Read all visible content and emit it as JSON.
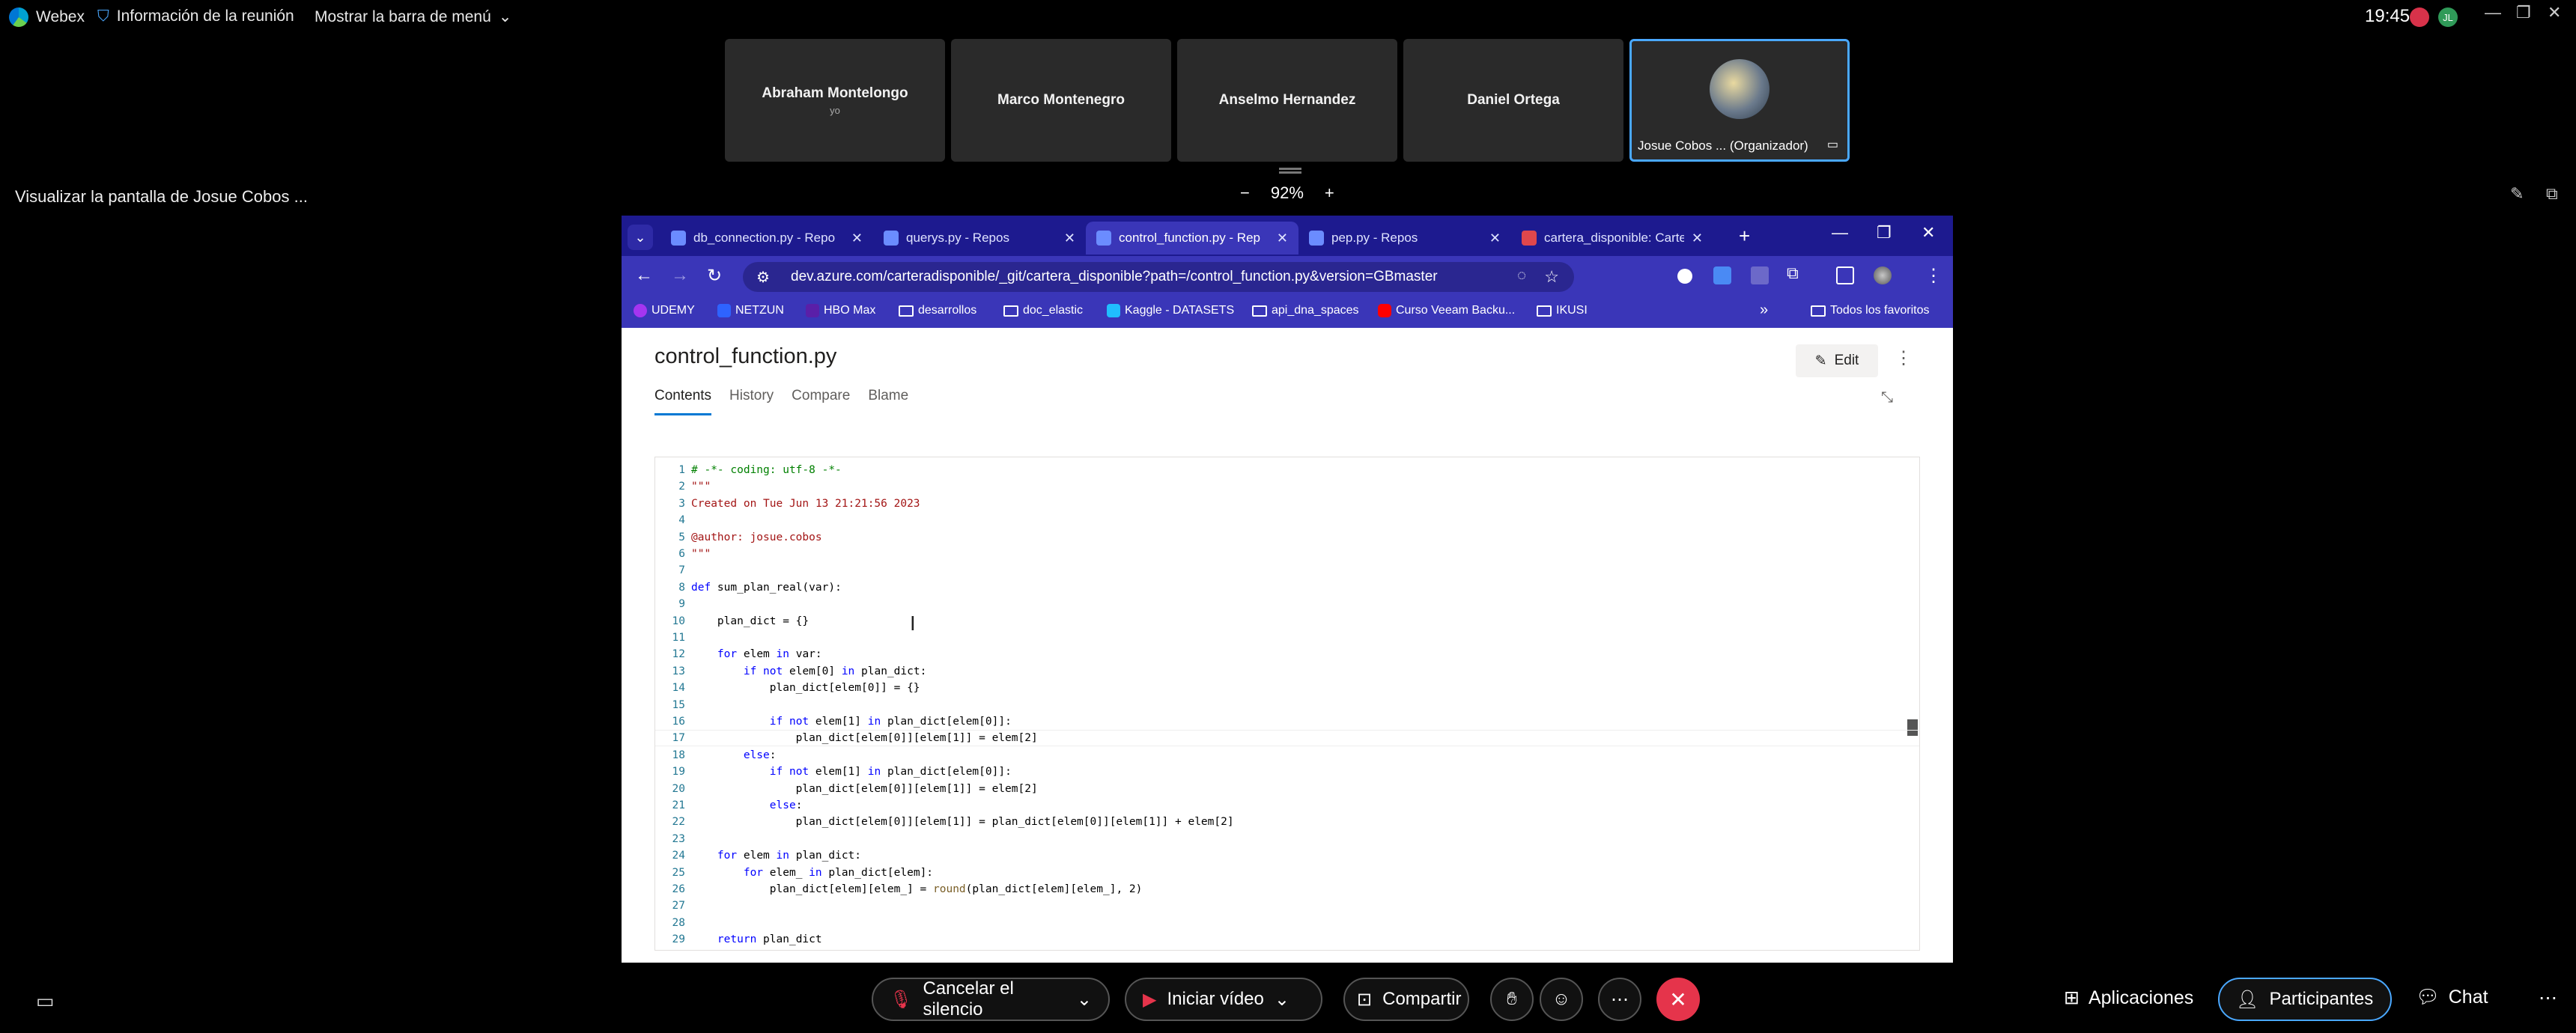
{
  "webex": {
    "app_name": "Webex",
    "meeting_info": "Información de la reunión",
    "menu_toggle": "Mostrar la barra de menú",
    "clock": "19:45",
    "avatar_initials": "JL",
    "share_label": "Visualizar la pantalla de Josue Cobos ...",
    "zoom": "92%",
    "zoom_minus": "−",
    "zoom_plus": "+",
    "window_controls": [
      "—",
      "❐",
      "✕"
    ]
  },
  "participants": [
    {
      "name": "Abraham Montelongo",
      "sub": "yo"
    },
    {
      "name": "Marco Montenegro",
      "sub": ""
    },
    {
      "name": "Anselmo Hernandez",
      "sub": ""
    },
    {
      "name": "Daniel Ortega",
      "sub": ""
    },
    {
      "name": "Josue Cobos ... (Organizador)",
      "sub": ""
    }
  ],
  "browser": {
    "tabs": [
      {
        "title": "db_connection.py - Repo",
        "active": false
      },
      {
        "title": "querys.py - Repos",
        "active": false
      },
      {
        "title": "control_function.py - Rep",
        "active": true
      },
      {
        "title": "pep.py - Repos",
        "active": false
      },
      {
        "title": "cartera_disponible: Carte",
        "active": false
      }
    ],
    "url": "dev.azure.com/carteradisponible/_git/cartera_disponible?path=/control_function.py&version=GBmaster",
    "bookmarks": [
      "UDEMY",
      "NETZUN",
      "HBO Max",
      "desarrollos",
      "doc_elastic",
      "Kaggle - DATASETS",
      "api_dna_spaces",
      "Curso Veeam Backu...",
      "IKUSI"
    ],
    "more_bookmarks": "»",
    "all_favorites": "Todos los favoritos",
    "colors": {
      "tabbar": "#1d1a8f",
      "toolbar": "#3a36b8"
    }
  },
  "page": {
    "file_title": "control_function.py",
    "edit_label": "Edit",
    "tabs": [
      "Contents",
      "History",
      "Compare",
      "Blame"
    ],
    "active_tab": "Contents"
  },
  "code": [
    {
      "n": "1",
      "t": "# -*- coding: utf-8 -*-"
    },
    {
      "n": "2",
      "t": "\"\"\""
    },
    {
      "n": "3",
      "t": "Created on Tue Jun 13 21:21:56 2023"
    },
    {
      "n": "4",
      "t": ""
    },
    {
      "n": "5",
      "t": "@author: josue.cobos"
    },
    {
      "n": "6",
      "t": "\"\"\""
    },
    {
      "n": "7",
      "t": ""
    },
    {
      "n": "8",
      "t": "def sum_plan_real(var):"
    },
    {
      "n": "9",
      "t": ""
    },
    {
      "n": "10",
      "t": "    plan_dict = {}"
    },
    {
      "n": "11",
      "t": ""
    },
    {
      "n": "12",
      "t": "    for elem in var:"
    },
    {
      "n": "13",
      "t": "        if not elem[0] in plan_dict:"
    },
    {
      "n": "14",
      "t": "            plan_dict[elem[0]] = {}"
    },
    {
      "n": "15",
      "t": ""
    },
    {
      "n": "16",
      "t": "            if not elem[1] in plan_dict[elem[0]]:"
    },
    {
      "n": "17",
      "t": "                plan_dict[elem[0]][elem[1]] = elem[2]"
    },
    {
      "n": "18",
      "t": "        else:"
    },
    {
      "n": "19",
      "t": "            if not elem[1] in plan_dict[elem[0]]:"
    },
    {
      "n": "20",
      "t": "                plan_dict[elem[0]][elem[1]] = elem[2]"
    },
    {
      "n": "21",
      "t": "            else:"
    },
    {
      "n": "22",
      "t": "                plan_dict[elem[0]][elem[1]] = plan_dict[elem[0]][elem[1]] + elem[2]"
    },
    {
      "n": "23",
      "t": ""
    },
    {
      "n": "24",
      "t": "    for elem in plan_dict:"
    },
    {
      "n": "25",
      "t": "        for elem_ in plan_dict[elem]:"
    },
    {
      "n": "26",
      "t": "            plan_dict[elem][elem_] = round(plan_dict[elem][elem_], 2)"
    },
    {
      "n": "27",
      "t": ""
    },
    {
      "n": "28",
      "t": ""
    },
    {
      "n": "29",
      "t": "    return plan_dict"
    }
  ],
  "controls": {
    "mute": "Cancelar el silencio",
    "video": "Iniciar vídeo",
    "share": "Compartir",
    "apps": "Aplicaciones",
    "participants": "Participantes",
    "chat": "Chat"
  }
}
